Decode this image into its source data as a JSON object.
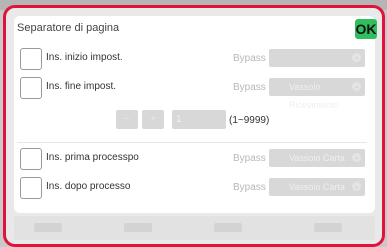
{
  "dialog": {
    "title": "Separatore di pagina",
    "ok_label": "OK"
  },
  "options": {
    "ins_inizio": {
      "label": "Ins. inizio impost.",
      "bypass_label": "Bypass",
      "tray_value": ""
    },
    "ins_fine": {
      "label": "Ins. fine impost.",
      "bypass_label": "Bypass",
      "tray_value": "Vassoio Ricevimento"
    },
    "ins_prima": {
      "label": "Ins. prima processpo",
      "bypass_label": "Bypass",
      "tray_value": "Vassoio Carta"
    },
    "ins_dopo": {
      "label": "Ins. dopo processo",
      "bypass_label": "Bypass",
      "tray_value": "Vassoio Carta"
    }
  },
  "counter": {
    "value": "1",
    "range_label": "(1~9999)"
  },
  "colors": {
    "accent_ok": "#2fbf5f",
    "frame_highlight": "#e0143a",
    "disabled_control": "#d8d8d8"
  }
}
